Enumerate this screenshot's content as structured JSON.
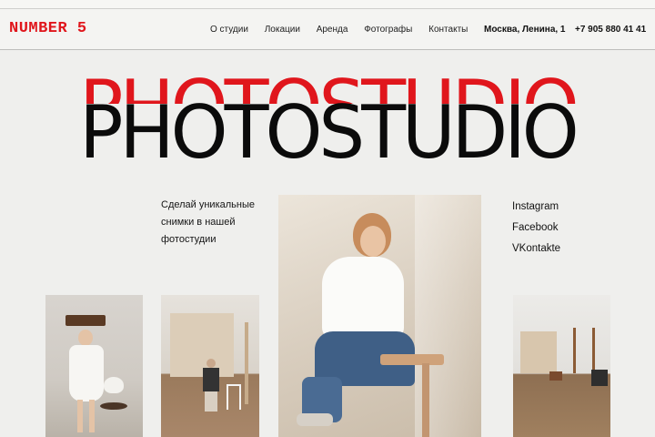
{
  "brand": {
    "logo": "NUMBER 5"
  },
  "nav": {
    "items": [
      "О студии",
      "Локации",
      "Аренда",
      "Фотографы",
      "Контакты"
    ]
  },
  "contact": {
    "address": "Москва, Ленина, 1",
    "phone": "+7 905 880 41 41"
  },
  "hero": {
    "title_red": "PHOTOSTUDIO",
    "title_black": "PHOTOSTUDIO"
  },
  "tagline": [
    "Сделай уникальные",
    "снимки в нашей",
    "фотостудии"
  ],
  "socials": [
    "Instagram",
    "Facebook",
    "VKontakte"
  ],
  "colors": {
    "accent": "#e0161c",
    "background": "#efefed",
    "text": "#111111"
  }
}
